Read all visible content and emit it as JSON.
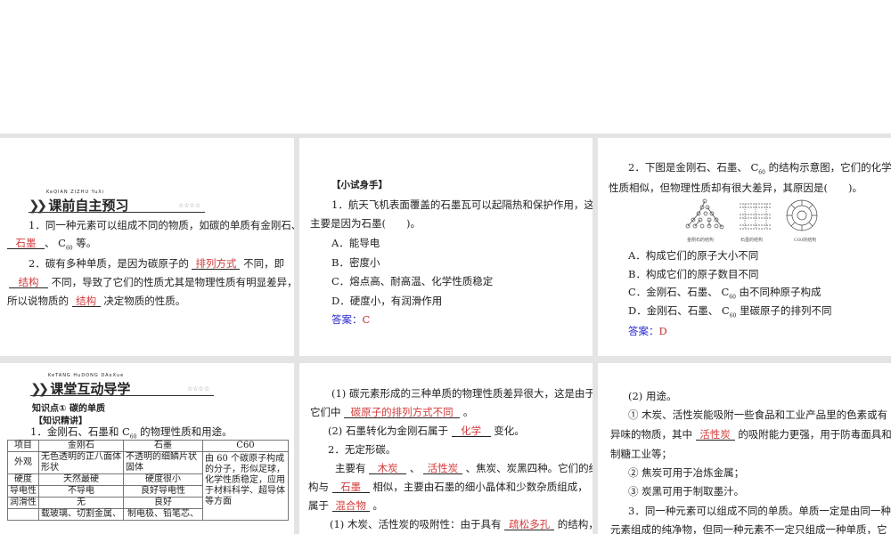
{
  "p1": {
    "pinyin": "KeQIAN ZIZHU YuXi",
    "title": "课前自主预习",
    "stars": "☆☆☆☆",
    "l1": "1．同一种元素可以组成不同的物质，如碳的单质有金刚石、",
    "a1": "石墨",
    "l2b": "、 C",
    "sub60": "60",
    "l2c": " 等。",
    "l3a": "2．碳有多种单质，是因为碳原子的",
    "a2": "排列方式",
    "l3b": "不同，即",
    "a3": "结构",
    "l4b": "不同，导致了它们的性质尤其是物理性质有明显差异，",
    "l5a": "所以说物质的",
    "a4": "结构",
    "l5b": "决定物质的性质。"
  },
  "p2": {
    "heading": "【小试身手】",
    "q1": "1．航天飞机表面覆盖的石墨瓦可以起隔热和保护作用，这",
    "q2": "主要是因为石墨(　　)。",
    "options": [
      "A．能导电",
      "B．密度小",
      "C．熔点高、耐高温、化学性质稳定",
      "D．硬度小，有润滑作用"
    ],
    "answer_label": "答案：",
    "answer": "C"
  },
  "p3": {
    "q1a": "2．下图是金刚石、石墨、 C",
    "q1b": " 的结构示意图，它们的化学",
    "q2": "性质相似，但物理性质却有很大差异，其原因是(　　)。",
    "captions": [
      "金刚石的结构",
      "石墨的结构",
      "C60的结构"
    ],
    "oA": "A．构成它们的原子大小不同",
    "oB": "B．构成它们的原子数目不同",
    "oCa": "C．金刚石、石墨、 C",
    "oCb": " 由不同种原子构成",
    "oDa": "D．金刚石、石墨、 C",
    "oDb": " 里碳原子的排列不同",
    "answer_label": "答案：",
    "answer": "D"
  },
  "p4": {
    "pinyin": "KeTANG HuDONG DAoXue",
    "title": "课堂互动导学",
    "stars": "☆☆☆☆",
    "kp": "知识点① 碳的单质",
    "sub": "【知识精讲】",
    "l1a": "1．金刚石、石墨和  C",
    "l1b": " 的物理性质和用途。",
    "table": {
      "headers": [
        "项目",
        "金刚石",
        "石墨",
        "C60"
      ],
      "rows": [
        [
          "外观",
          "无色透明的正八面体形状",
          "不透明的细鳞片状固体"
        ],
        [
          "硬度",
          "天然最硬",
          "硬度很小"
        ],
        [
          "导电性",
          "不导电",
          "良好导电性"
        ],
        [
          "润滑性",
          "无",
          "良好"
        ],
        [
          "",
          "载玻璃、切割金属、",
          "制电极、铅笔芯、"
        ]
      ],
      "c60": "由 60 个碳原子构成的分子，形似足球，化学性质稳定，应用于材料科学、超导体等方面"
    }
  },
  "p5": {
    "l1": "(1) 碳元素形成的三种单质的物理性质差异很大，这是由于",
    "l2a": "它们中",
    "a1": "碳原子的排列方式不同",
    "l2b": "。",
    "l3a": "(2) 石墨转化为金刚石属于",
    "a2": "化学",
    "l3b": "变化。",
    "l4": "2．无定形碳。",
    "l5a": "主要有",
    "a3": "木炭",
    "l5b": "、",
    "a4": "活性炭",
    "l5c": "、焦炭、炭黑四种。它们的结",
    "l6a": "构与",
    "a5": "石墨",
    "l6b": "相似，主要由石墨的细小晶体和少数杂质组成，",
    "l7a": "属于",
    "a6": "混合物",
    "l7b": "。",
    "l8a": "(1) 木炭、活性炭的吸附性：由于具有",
    "a7": "疏松多孔",
    "l8b": "的结构，"
  },
  "p6": {
    "l1": "(2) 用途。",
    "l2": "① 木炭、活性炭能吸附一些食品和工业产品里的色素或有",
    "l3a": "异味的物质，其中",
    "a1": "活性炭",
    "l3b": "的吸附能力更强，用于防毒面具和",
    "l4": "制糖工业等；",
    "l5": "② 焦炭可用于冶炼金属；",
    "l6": "③ 炭黑可用于制取墨汁。",
    "l7": "3．同一种元素可以组成不同的单质。单质一定是由同一种",
    "l8": "元素组成的纯净物，但同一种元素不一定只组成一种单质，它"
  }
}
